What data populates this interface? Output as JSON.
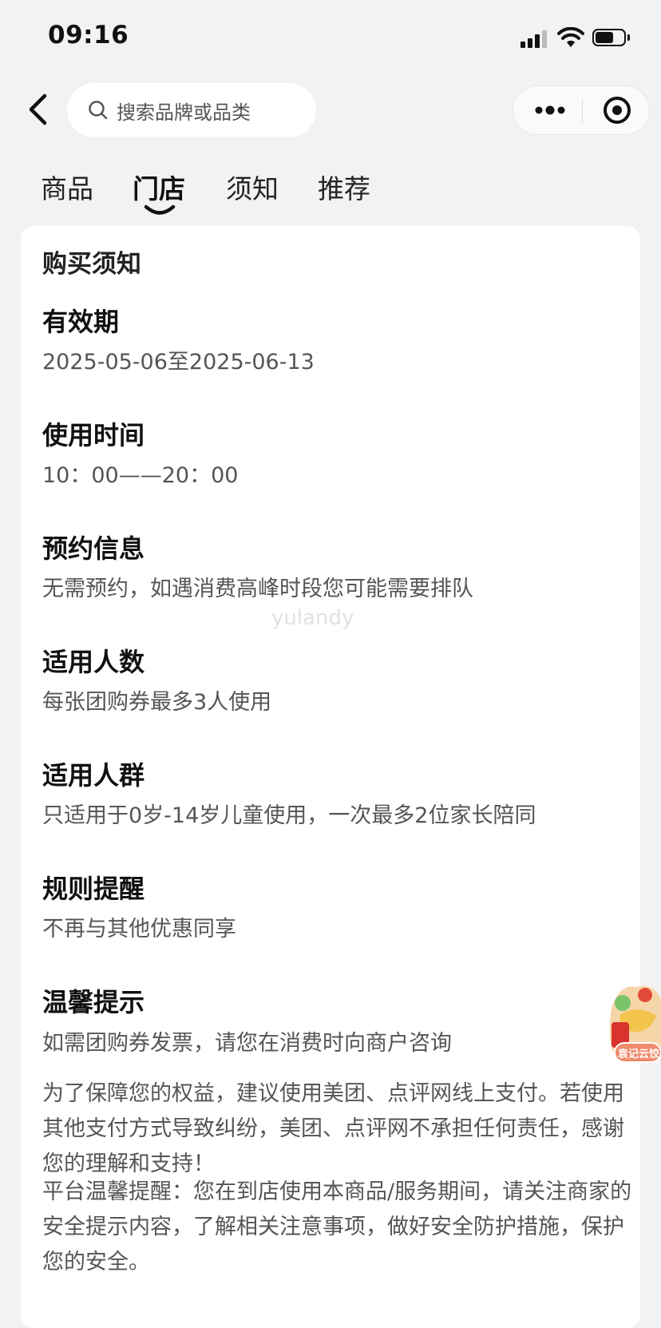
{
  "status_bar": {
    "time": "09:16"
  },
  "nav": {
    "search_placeholder": "搜索品牌或品类"
  },
  "tabs": [
    {
      "label": "商品",
      "active": false
    },
    {
      "label": "门店",
      "active": true
    },
    {
      "label": "须知",
      "active": false
    },
    {
      "label": "推荐",
      "active": false
    }
  ],
  "card": {
    "title": "购买须知",
    "sections": [
      {
        "title": "有效期",
        "lines": [
          "2025-05-06至2025-06-13"
        ]
      },
      {
        "title": "使用时间",
        "lines": [
          "10：00——20：00"
        ]
      },
      {
        "title": "预约信息",
        "lines": [
          "无需预约，如遇消费高峰时段您可能需要排队"
        ]
      },
      {
        "title": "适用人数",
        "lines": [
          "每张团购券最多3人使用"
        ]
      },
      {
        "title": "适用人群",
        "lines": [
          "只适用于0岁-14岁儿童使用，一次最多2位家长陪同"
        ]
      },
      {
        "title": "规则提醒",
        "lines": [
          "不再与其他优惠同享"
        ]
      },
      {
        "title": "温馨提示",
        "lines": [
          "如需团购券发票，请您在消费时向商户咨询",
          "为了保障您的权益，建议使用美团、点评网线上支付。若使用其他支付方式导致纠纷，美团、点评网不承担任何责任，感谢您的理解和支持！",
          "平台温馨提醒：您在到店使用本商品/服务期间，请关注商家的安全提示内容，了解相关注意事项，做好安全防护措施，保护您的安全。"
        ]
      }
    ]
  },
  "watermark": "yulandy",
  "float_badge": {
    "label": "袁记云饺"
  },
  "colors": {
    "background": "#f2f2f4",
    "card": "#ffffff",
    "title": "#111111",
    "body_text": "#555555"
  }
}
